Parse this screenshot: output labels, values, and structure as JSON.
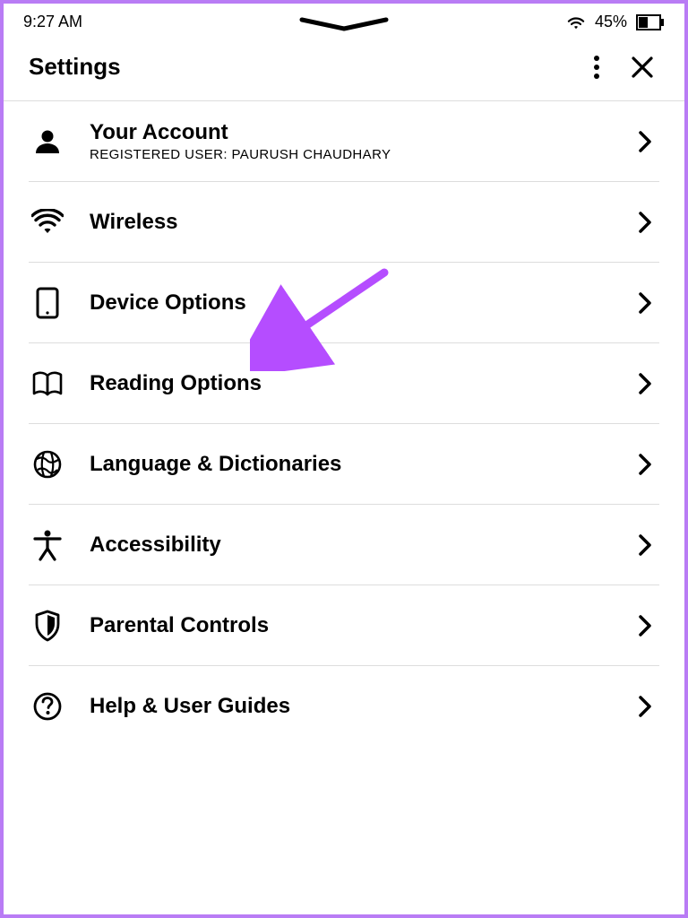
{
  "status": {
    "time": "9:27 AM",
    "battery_text": "45%"
  },
  "header": {
    "title": "Settings"
  },
  "rows": {
    "account": {
      "title": "Your Account",
      "subtitle": "REGISTERED USER: PAURUSH CHAUDHARY"
    },
    "wireless": {
      "title": "Wireless"
    },
    "device": {
      "title": "Device Options"
    },
    "reading": {
      "title": "Reading Options"
    },
    "language": {
      "title": "Language & Dictionaries"
    },
    "access": {
      "title": "Accessibility"
    },
    "parental": {
      "title": "Parental Controls"
    },
    "help": {
      "title": "Help & User Guides"
    }
  }
}
